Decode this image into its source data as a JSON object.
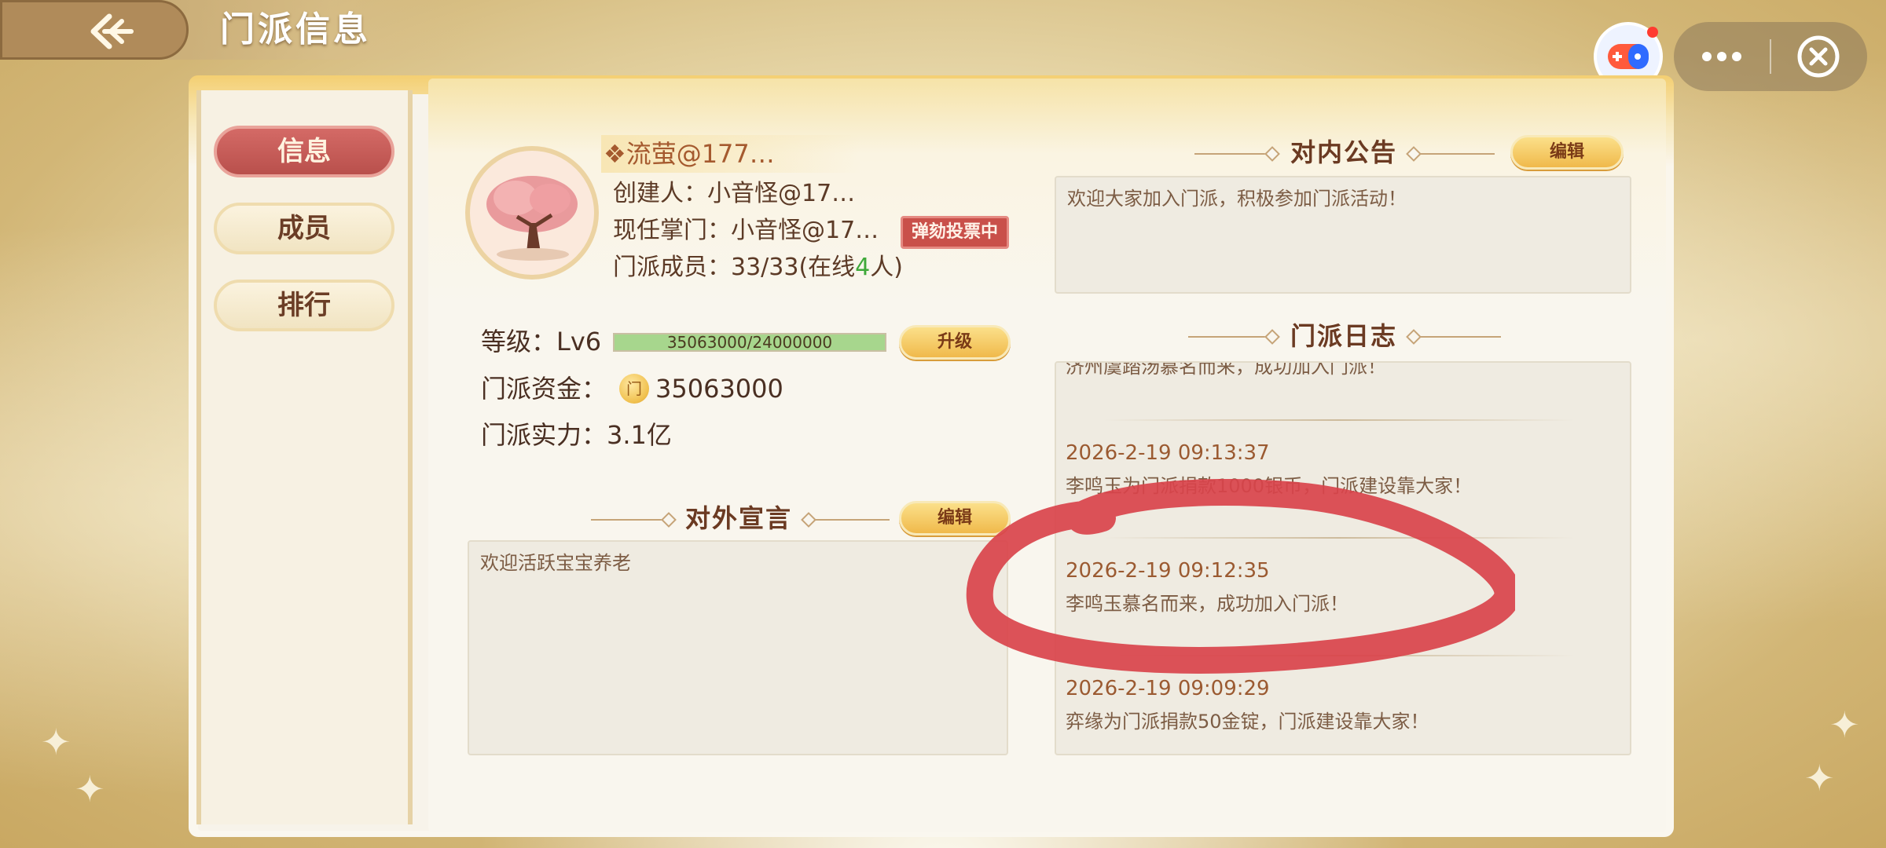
{
  "header": {
    "title": "门派信息"
  },
  "tabs": [
    {
      "label": "信息",
      "active": true
    },
    {
      "label": "成员",
      "active": false
    },
    {
      "label": "排行",
      "active": false
    }
  ],
  "profile": {
    "sect_name": "❖流萤@177…",
    "creator": "创建人：小音怪@17…",
    "leader": "现任掌门：小音怪@17…",
    "impeach_badge": "弹劾投票中",
    "members_prefix": "门派成员：33/33(在线",
    "members_online": "4",
    "members_suffix": "人)"
  },
  "stats": {
    "level_label": "等级：Lv6",
    "exp_text": "35063000/24000000",
    "exp_fill": 1.0,
    "upgrade_button": "升级",
    "funds_label": "门派资金：",
    "coin_glyph": "门",
    "funds_value": "35063000",
    "strength_label": "门派实力：3.1亿"
  },
  "declaration": {
    "title": "对外宣言",
    "edit_button": "编辑",
    "text": "欢迎活跃宝宝养老"
  },
  "notice": {
    "title": "对内公告",
    "edit_button": "编辑",
    "text": "欢迎大家加入门派，积极参加门派活动！"
  },
  "log": {
    "title": "门派日志",
    "partial_text": "济州虞踏汤慕名而来，成功加入门派！",
    "entries": [
      {
        "time": "2026-2-19   09:13:37",
        "message": "李鸣玉为门派捐款1000银币，门派建设靠大家！"
      },
      {
        "time": "2026-2-19   09:12:35",
        "message": "李鸣玉慕名而来，成功加入门派！"
      },
      {
        "time": "2026-2-19   09:09:29",
        "message": "弈缘为门派捐款50金锭，门派建设靠大家！"
      }
    ]
  },
  "colors": {
    "accent_red": "#c9504a",
    "gold": "#f0b94b",
    "brown_text": "#5c3a26",
    "online_green": "#3fa93a",
    "annotation_red": "#d9434b"
  },
  "icons": {
    "back": "back-arrow-icon",
    "game": "gamepad-icon",
    "more": "more-dots-icon",
    "close": "close-circle-icon",
    "coin": "coin-icon"
  }
}
